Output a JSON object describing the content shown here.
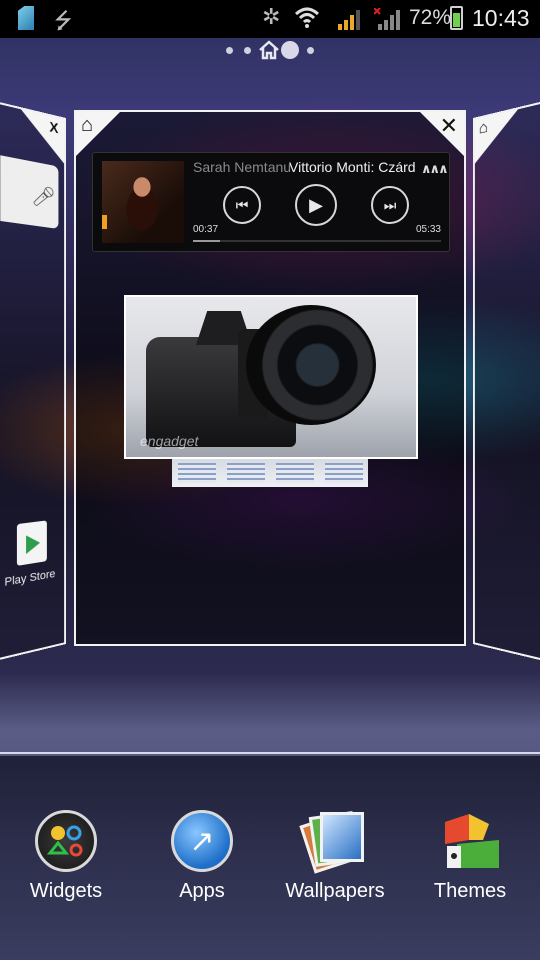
{
  "status_bar": {
    "battery_percent": "72%",
    "battery_level": 0.72,
    "time": "10:43",
    "icons": [
      "sim-icon",
      "usb-icon",
      "bluetooth-icon",
      "wifi-icon",
      "signal-icon",
      "signal-no-data-icon",
      "battery-charging-icon"
    ]
  },
  "pager": {
    "pages": 5,
    "active_index": 3
  },
  "music_widget": {
    "artist": "Sarah Nemtanu",
    "track": "Vittorio Monti: Czárdá",
    "elapsed": "00:37",
    "duration": "05:33",
    "progress": 0.11
  },
  "photo_widget": {
    "watermark": "engadget"
  },
  "left_screen": {
    "app_label": "Play Store"
  },
  "dock": {
    "widgets_label": "Widgets",
    "apps_label": "Apps",
    "wallpapers_label": "Wallpapers",
    "themes_label": "Themes"
  },
  "colors": {
    "accent": "#6ed34a",
    "status_bar_bg": "#000000",
    "frame": "#f2f2f2"
  }
}
